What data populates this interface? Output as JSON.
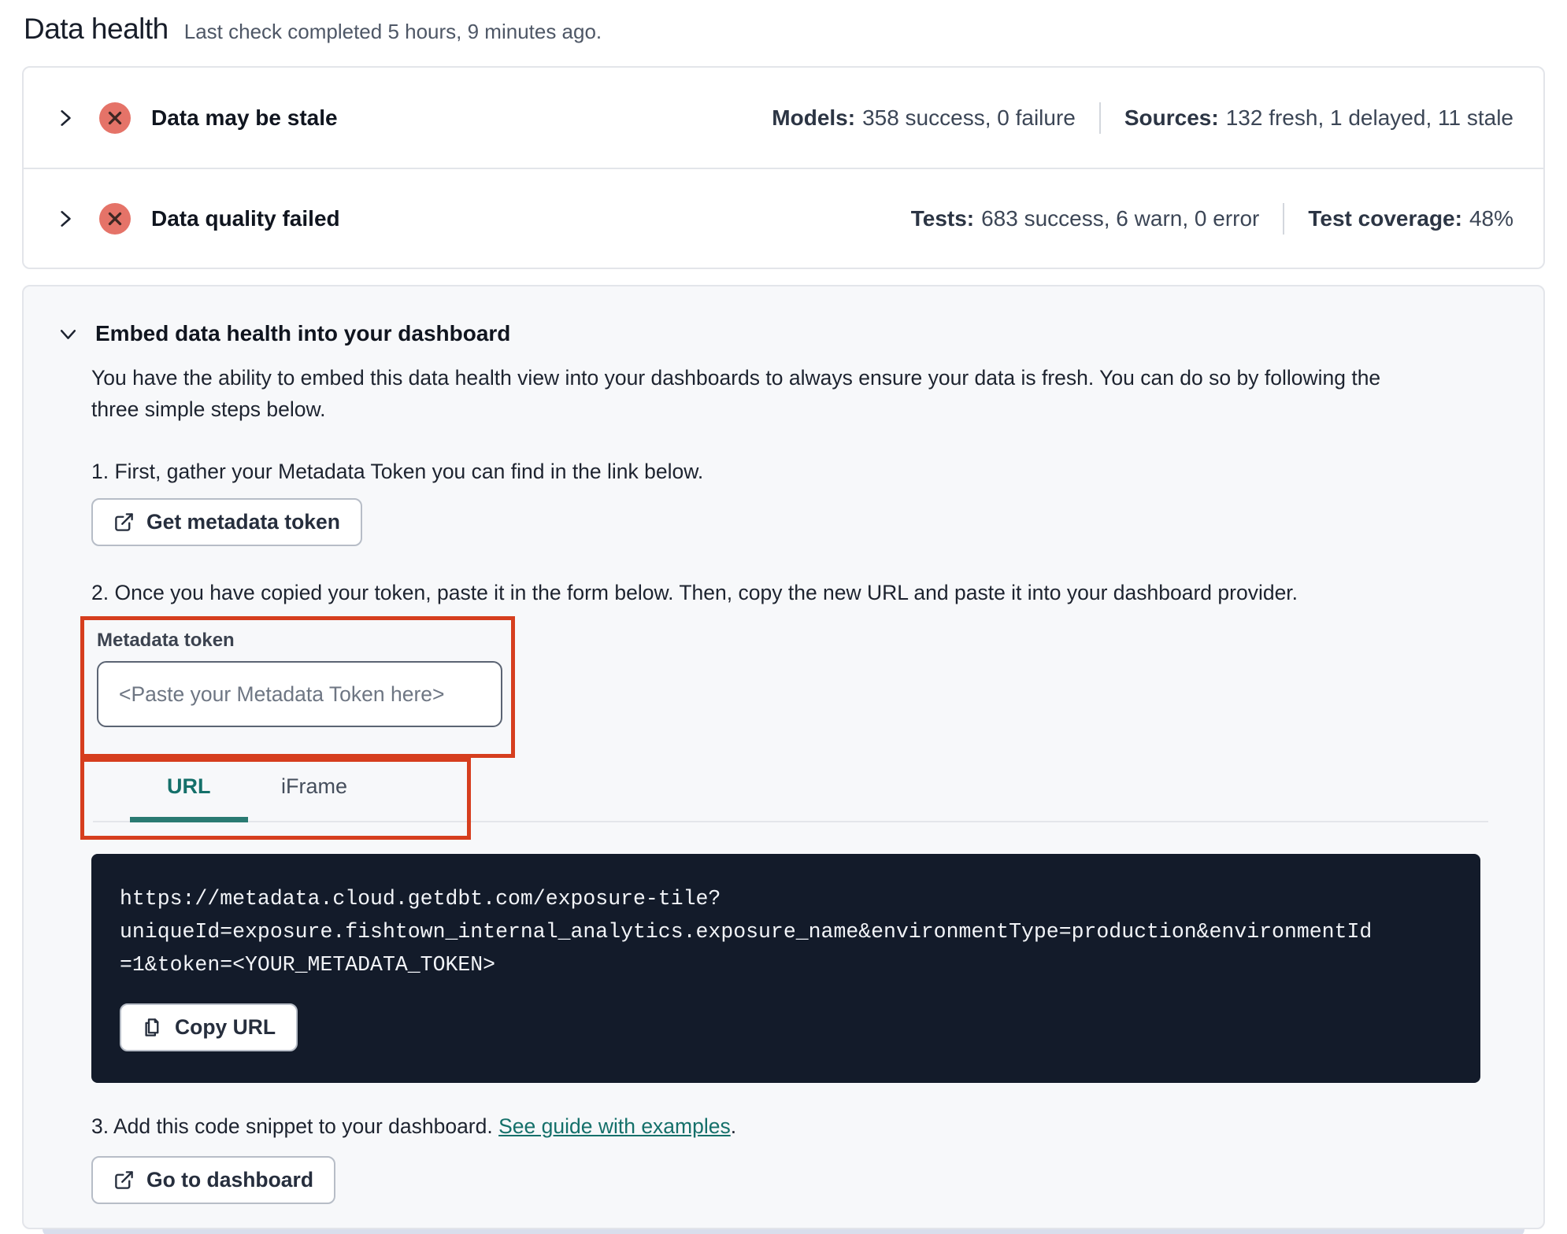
{
  "page": {
    "title": "Data health",
    "subtitle": "Last check completed 5 hours, 9 minutes ago."
  },
  "status_rows": [
    {
      "title": "Data may be stale",
      "stats": [
        {
          "label": "Models:",
          "value": "358 success, 0 failure"
        },
        {
          "label": "Sources:",
          "value": "132 fresh, 1 delayed, 11 stale"
        }
      ]
    },
    {
      "title": "Data quality failed",
      "stats": [
        {
          "label": "Tests:",
          "value": "683 success, 6 warn, 0 error"
        },
        {
          "label": "Test coverage:",
          "value": "48%"
        }
      ]
    }
  ],
  "embed": {
    "heading": "Embed data health into your dashboard",
    "description": "You have the ability to embed this data health view into your dashboards to always ensure your data is fresh. You can do so by following the three simple steps below.",
    "step1": "1. First, gather your Metadata Token you can find in the link below.",
    "get_token_button": "Get metadata token",
    "step2": "2. Once you have copied your token, paste it in the form below. Then, copy the new URL and paste it into your dashboard provider.",
    "token_field": {
      "label": "Metadata token",
      "value": "",
      "placeholder": "<Paste your Metadata Token here>"
    },
    "tabs": [
      {
        "label": "URL",
        "active": true
      },
      {
        "label": "iFrame",
        "active": false
      }
    ],
    "code_url": "https://metadata.cloud.getdbt.com/exposure-tile?uniqueId=exposure.fishtown_internal_analytics.exposure_name&environmentType=production&environmentId=1&token=<YOUR_METADATA_TOKEN>",
    "code_lines": [
      "https://metadata.cloud.getdbt.com/exposure-tile?",
      "uniqueId=exposure.fishtown_internal_analytics.exposure_name&environmentType=production&environmentId",
      "=1&token=<YOUR_METADATA_TOKEN>"
    ],
    "copy_button": "Copy URL",
    "step3_prefix": "3. Add this code snippet to your dashboard. ",
    "step3_link": "See guide with examples",
    "step3_suffix": ".",
    "dashboard_button": "Go to dashboard"
  },
  "colors": {
    "annotation_red": "#d63e1e",
    "teal_accent": "#15706a",
    "error_icon_fill": "#e57368",
    "code_background": "#131b2a",
    "card_background": "#f7f8fa"
  }
}
